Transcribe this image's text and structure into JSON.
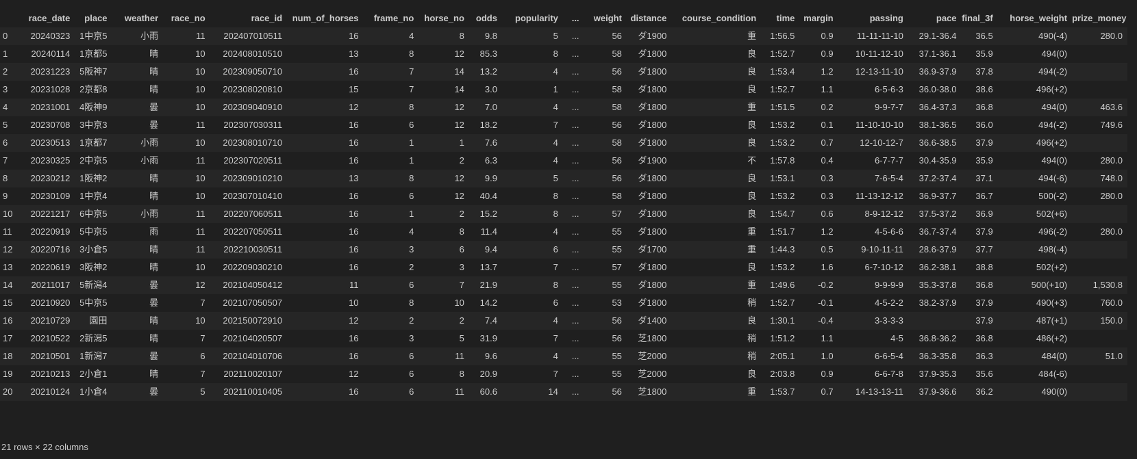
{
  "columns": [
    "race_date",
    "place",
    "weather",
    "race_no",
    "race_id",
    "num_of_horses",
    "frame_no",
    "horse_no",
    "odds",
    "popularity",
    "...",
    "weight",
    "distance",
    "course_condition",
    "time",
    "margin",
    "passing",
    "pace",
    "final_3f",
    "horse_weight",
    "prize_money"
  ],
  "rows": [
    {
      "index": "0",
      "cells": [
        "20240323",
        "1中京5",
        "小雨",
        "11",
        "202407010511",
        "16",
        "4",
        "8",
        "9.8",
        "5",
        "...",
        "56",
        "ダ1900",
        "重",
        "1:56.5",
        "0.9",
        "11-11-11-10",
        "29.1-36.4",
        "36.5",
        "490(-4)",
        "280.0"
      ]
    },
    {
      "index": "1",
      "cells": [
        "20240114",
        "1京都5",
        "晴",
        "10",
        "202408010510",
        "13",
        "8",
        "12",
        "85.3",
        "8",
        "...",
        "58",
        "ダ1800",
        "良",
        "1:52.7",
        "0.9",
        "10-11-12-10",
        "37.1-36.1",
        "35.9",
        "494(0)",
        ""
      ]
    },
    {
      "index": "2",
      "cells": [
        "20231223",
        "5阪神7",
        "晴",
        "10",
        "202309050710",
        "16",
        "7",
        "14",
        "13.2",
        "4",
        "...",
        "56",
        "ダ1800",
        "良",
        "1:53.4",
        "1.2",
        "12-13-11-10",
        "36.9-37.9",
        "37.8",
        "494(-2)",
        ""
      ]
    },
    {
      "index": "3",
      "cells": [
        "20231028",
        "2京都8",
        "晴",
        "10",
        "202308020810",
        "15",
        "7",
        "14",
        "3.0",
        "1",
        "...",
        "58",
        "ダ1800",
        "良",
        "1:52.7",
        "1.1",
        "6-5-6-3",
        "36.0-38.0",
        "38.6",
        "496(+2)",
        ""
      ]
    },
    {
      "index": "4",
      "cells": [
        "20231001",
        "4阪神9",
        "曇",
        "10",
        "202309040910",
        "12",
        "8",
        "12",
        "7.0",
        "4",
        "...",
        "58",
        "ダ1800",
        "重",
        "1:51.5",
        "0.2",
        "9-9-7-7",
        "36.4-37.3",
        "36.8",
        "494(0)",
        "463.6"
      ]
    },
    {
      "index": "5",
      "cells": [
        "20230708",
        "3中京3",
        "曇",
        "11",
        "202307030311",
        "16",
        "6",
        "12",
        "18.2",
        "7",
        "...",
        "56",
        "ダ1800",
        "良",
        "1:53.2",
        "0.1",
        "11-10-10-10",
        "38.1-36.5",
        "36.0",
        "494(-2)",
        "749.6"
      ]
    },
    {
      "index": "6",
      "cells": [
        "20230513",
        "1京都7",
        "小雨",
        "10",
        "202308010710",
        "16",
        "1",
        "1",
        "7.6",
        "4",
        "...",
        "58",
        "ダ1800",
        "良",
        "1:53.2",
        "0.7",
        "12-10-12-7",
        "36.6-38.5",
        "37.9",
        "496(+2)",
        ""
      ]
    },
    {
      "index": "7",
      "cells": [
        "20230325",
        "2中京5",
        "小雨",
        "11",
        "202307020511",
        "16",
        "1",
        "2",
        "6.3",
        "4",
        "...",
        "56",
        "ダ1900",
        "不",
        "1:57.8",
        "0.4",
        "6-7-7-7",
        "30.4-35.9",
        "35.9",
        "494(0)",
        "280.0"
      ]
    },
    {
      "index": "8",
      "cells": [
        "20230212",
        "1阪神2",
        "晴",
        "10",
        "202309010210",
        "13",
        "8",
        "12",
        "9.9",
        "5",
        "...",
        "56",
        "ダ1800",
        "良",
        "1:53.1",
        "0.3",
        "7-6-5-4",
        "37.2-37.4",
        "37.1",
        "494(-6)",
        "748.0"
      ]
    },
    {
      "index": "9",
      "cells": [
        "20230109",
        "1中京4",
        "晴",
        "10",
        "202307010410",
        "16",
        "6",
        "12",
        "40.4",
        "8",
        "...",
        "58",
        "ダ1800",
        "良",
        "1:53.2",
        "0.3",
        "11-13-12-12",
        "36.9-37.7",
        "36.7",
        "500(-2)",
        "280.0"
      ]
    },
    {
      "index": "10",
      "cells": [
        "20221217",
        "6中京5",
        "小雨",
        "11",
        "202207060511",
        "16",
        "1",
        "2",
        "15.2",
        "8",
        "...",
        "57",
        "ダ1800",
        "良",
        "1:54.7",
        "0.6",
        "8-9-12-12",
        "37.5-37.2",
        "36.9",
        "502(+6)",
        ""
      ]
    },
    {
      "index": "11",
      "cells": [
        "20220919",
        "5中京5",
        "雨",
        "11",
        "202207050511",
        "16",
        "4",
        "8",
        "11.4",
        "4",
        "...",
        "55",
        "ダ1800",
        "重",
        "1:51.7",
        "1.2",
        "4-5-6-6",
        "36.7-37.4",
        "37.9",
        "496(-2)",
        "280.0"
      ]
    },
    {
      "index": "12",
      "cells": [
        "20220716",
        "3小倉5",
        "晴",
        "11",
        "202210030511",
        "16",
        "3",
        "6",
        "9.4",
        "6",
        "...",
        "55",
        "ダ1700",
        "重",
        "1:44.3",
        "0.5",
        "9-10-11-11",
        "28.6-37.9",
        "37.7",
        "498(-4)",
        ""
      ]
    },
    {
      "index": "13",
      "cells": [
        "20220619",
        "3阪神2",
        "晴",
        "10",
        "202209030210",
        "16",
        "2",
        "3",
        "13.7",
        "7",
        "...",
        "57",
        "ダ1800",
        "良",
        "1:53.2",
        "1.6",
        "6-7-10-12",
        "36.2-38.1",
        "38.8",
        "502(+2)",
        ""
      ]
    },
    {
      "index": "14",
      "cells": [
        "20211017",
        "5新潟4",
        "曇",
        "12",
        "202104050412",
        "11",
        "6",
        "7",
        "21.9",
        "8",
        "...",
        "55",
        "ダ1800",
        "重",
        "1:49.6",
        "-0.2",
        "9-9-9-9",
        "35.3-37.8",
        "36.8",
        "500(+10)",
        "1,530.8"
      ]
    },
    {
      "index": "15",
      "cells": [
        "20210920",
        "5中京5",
        "曇",
        "7",
        "202107050507",
        "10",
        "8",
        "10",
        "14.2",
        "6",
        "...",
        "53",
        "ダ1800",
        "稍",
        "1:52.7",
        "-0.1",
        "4-5-2-2",
        "38.2-37.9",
        "37.9",
        "490(+3)",
        "760.0"
      ]
    },
    {
      "index": "16",
      "cells": [
        "20210729",
        "園田",
        "晴",
        "10",
        "202150072910",
        "12",
        "2",
        "2",
        "7.4",
        "4",
        "...",
        "56",
        "ダ1400",
        "良",
        "1:30.1",
        "-0.4",
        "3-3-3-3",
        "",
        "37.9",
        "487(+1)",
        "150.0"
      ]
    },
    {
      "index": "17",
      "cells": [
        "20210522",
        "2新潟5",
        "晴",
        "7",
        "202104020507",
        "16",
        "3",
        "5",
        "31.9",
        "7",
        "...",
        "56",
        "芝1800",
        "稍",
        "1:51.2",
        "1.1",
        "4-5",
        "36.8-36.2",
        "36.8",
        "486(+2)",
        ""
      ]
    },
    {
      "index": "18",
      "cells": [
        "20210501",
        "1新潟7",
        "曇",
        "6",
        "202104010706",
        "16",
        "6",
        "11",
        "9.6",
        "4",
        "...",
        "55",
        "芝2000",
        "稍",
        "2:05.1",
        "1.0",
        "6-6-5-4",
        "36.3-35.8",
        "36.3",
        "484(0)",
        "51.0"
      ]
    },
    {
      "index": "19",
      "cells": [
        "20210213",
        "2小倉1",
        "晴",
        "7",
        "202110020107",
        "12",
        "6",
        "8",
        "20.9",
        "7",
        "...",
        "55",
        "芝2000",
        "良",
        "2:03.8",
        "0.9",
        "6-6-7-8",
        "37.9-35.3",
        "35.6",
        "484(-6)",
        ""
      ]
    },
    {
      "index": "20",
      "cells": [
        "20210124",
        "1小倉4",
        "曇",
        "5",
        "202110010405",
        "16",
        "6",
        "11",
        "60.6",
        "14",
        "...",
        "56",
        "芝1800",
        "重",
        "1:53.7",
        "0.7",
        "14-13-13-11",
        "37.9-36.6",
        "36.2",
        "490(0)",
        ""
      ]
    }
  ],
  "footer": "21 rows × 22 columns"
}
